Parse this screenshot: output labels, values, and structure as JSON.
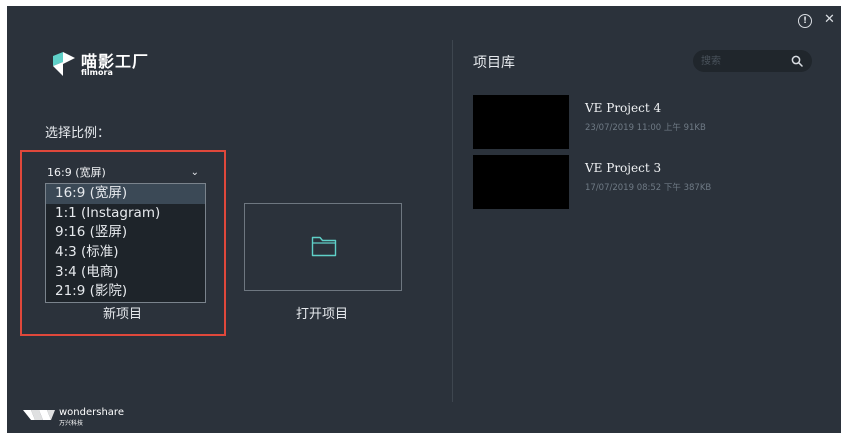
{
  "window": {
    "info_glyph": "!",
    "close_glyph": "✕"
  },
  "logo": {
    "title": "喵影工厂",
    "subtitle": "filmora"
  },
  "new_project": {
    "ratio_label": "选择比例：",
    "selected_ratio": "16:9 (宽屏)",
    "chevron": "⌄",
    "ratio_options": [
      "16:9 (宽屏)",
      "1:1 (Instagram)",
      "9:16 (竖屏)",
      "4:3 (标准)",
      "3:4 (电商)",
      "21:9 (影院)"
    ],
    "label": "新项目"
  },
  "open_project": {
    "label": "打开项目"
  },
  "library": {
    "title": "项目库",
    "search_placeholder": "搜索",
    "projects": [
      {
        "name": "VE Project 4",
        "meta": "23/07/2019 11:00 上午  91KB"
      },
      {
        "name": "VE Project 3",
        "meta": "17/07/2019 08:52 下午  387KB"
      }
    ]
  },
  "brand": {
    "name": "wondershare",
    "subtitle": "万兴科技"
  },
  "colors": {
    "background": "#2b323b",
    "highlight_border": "#e0483b",
    "accent_teal": "#5fd0c8"
  }
}
